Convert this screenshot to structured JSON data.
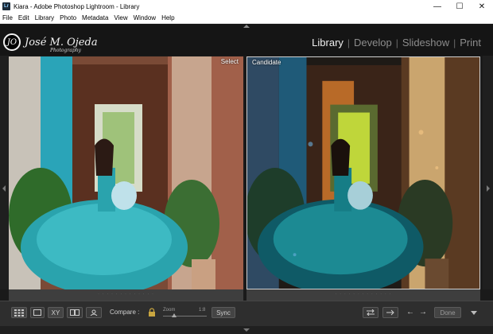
{
  "window": {
    "title": "Kiara - Adobe Photoshop Lightroom - Library",
    "app_icon_text": "Lr",
    "controls": {
      "minimize": "—",
      "maximize": "☐",
      "close": "✕"
    }
  },
  "menu": [
    "File",
    "Edit",
    "Library",
    "Photo",
    "Metadata",
    "View",
    "Window",
    "Help"
  ],
  "identity_plate": {
    "monogram": "JO",
    "name": "José M. Ojeda",
    "tagline": "Photography"
  },
  "modules": {
    "items": [
      {
        "label": "Library",
        "active": true
      },
      {
        "label": "Develop",
        "active": false
      },
      {
        "label": "Slideshow",
        "active": false
      },
      {
        "label": "Print",
        "active": false
      }
    ],
    "separator": "|"
  },
  "compare": {
    "select_label": "Select",
    "candidate_label": "Candidate",
    "strip_dots": "· · · · · · · · · · · · ·"
  },
  "toolbar": {
    "compare_label": "Compare :",
    "zoom_label": "Zoom",
    "zoom_value": "1:8",
    "zoom_level": 0.25,
    "sync_label": "Sync",
    "done_label": "Done",
    "prev_arrow": "←",
    "next_arrow": "→",
    "xy_label": "XY"
  },
  "colors": {
    "accent_active": "#f0f0f0",
    "module_inactive": "#8c8c8c",
    "panel_bg": "#1a1a1a",
    "toolbar_bg": "#2e2e2e"
  }
}
